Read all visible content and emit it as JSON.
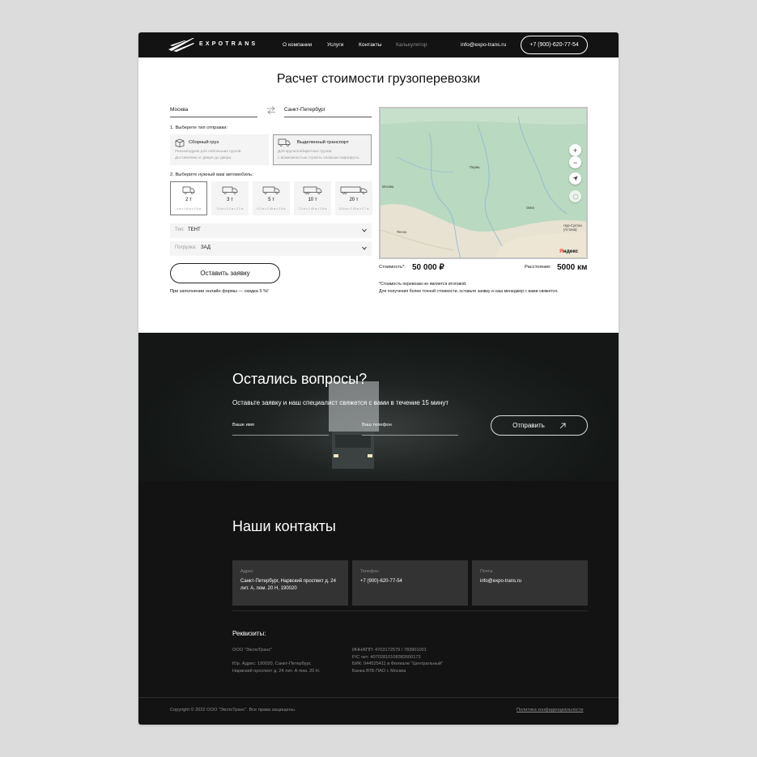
{
  "header": {
    "logo_text": "EXPOTRANS",
    "nav": [
      {
        "label": "О компании"
      },
      {
        "label": "Услуги"
      },
      {
        "label": "Контакты"
      },
      {
        "label": "Калькулятор"
      }
    ],
    "email": "info@expo-trans.ru",
    "phone": "+7 (900)-620-77-54"
  },
  "calculator": {
    "title": "Расчет стоимости грузоперевозки",
    "from_city": "Москва",
    "to_city": "Санкт-Петербург",
    "step1_label": "1. Выберете тип отправки:",
    "shipping_types": [
      {
        "title": "Сборный груз",
        "desc_line1": "Рекомендуем для небольших грузов.",
        "desc_line2": "Доставляем от двери до двери.",
        "icon": "box-icon"
      },
      {
        "title": "Выделенный транспорт",
        "desc_line1": "Для крупногабаритных грузов,",
        "desc_line2": "с возможностью строить сложные маршруты.",
        "icon": "truck-icon"
      }
    ],
    "step2_label": "2. Выберите нужный вам автомобиль:",
    "vehicles": [
      {
        "weight": "2 т",
        "size": "4 м х 1.8 м х 1.8 м"
      },
      {
        "weight": "3 т",
        "size": "3.5 м х 2.2 м х 2.2 м"
      },
      {
        "weight": "5 т",
        "size": "6.2 м х 2.45 м х 2.5 м"
      },
      {
        "weight": "10 т",
        "size": "7.2 м х 2.45 м х 2.6 м"
      },
      {
        "weight": "20 т",
        "size": "13.6 м х 2.45 м х 2.7 м"
      }
    ],
    "type_label": "Тип:",
    "type_value": "ТЕНТ",
    "loading_label": "Погрузка:",
    "loading_value": "ЗАД",
    "submit_label": "Оставить заявку",
    "discount_note": "При заполнении онлайн формы — скидка 5 %!",
    "cost_label": "Стоимость*:",
    "cost_value": "50 000 ₽",
    "distance_label": "Расстояние:",
    "distance_value": "5000 км",
    "footnote_line1": "*Стоимость перевозки не является итоговой.",
    "footnote_line2": "Для получения более точной стоимости, оставьте заявку и наш менеджер с вами свяжется.",
    "map": {
      "zoom_in": "+",
      "zoom_out": "−",
      "brand_prefix": "Я",
      "brand_rest": "ндекс",
      "cities": [
        "Москва",
        "Пермь",
        "Пенза",
        "Омск",
        "Нур-Султан (Астана)"
      ]
    }
  },
  "questions": {
    "title": "Остались вопросы?",
    "subtitle": "Оставьте заявку и наш специалист свяжется с вами в течение 15 минут",
    "name_placeholder": "Ваше имя",
    "phone_placeholder": "Ваш телефон",
    "send_label": "Отправить"
  },
  "contacts": {
    "title": "Наши контакты",
    "cards": [
      {
        "key": "Адрес:",
        "value": "Санкт-Петербург, Нарвский проспект д. 24 лит. А, пом. 20 Н, 190020"
      },
      {
        "key": "Телефон:",
        "value": "+7 (900)-620-77-54"
      },
      {
        "key": "Почта:",
        "value": "info@expo-trans.ru"
      }
    ],
    "requisites_title": "Реквизиты:",
    "company": "ООО \"ЭкспоТранс\"",
    "legal_address_line1": "Юр. Адрес: 190020, Санкт-Петербург,",
    "legal_address_line2": "Нарвский проспект д. 24 лит. А пом. 20 Н.",
    "inn": "ИНН/КПП: 4703172579 / 783901001",
    "account": "Р/С чет: 40702810108382600173",
    "bik": "БИК: 044525411 в Филиале \"Центральный\"",
    "bank": "Банка ВТБ ПАО г. Москва"
  },
  "footer": {
    "copyright": "Copyright © 2022 ООО \"ЭкспоТранс\". Все права защищены.",
    "policy": "Политика конфиденциальности"
  }
}
